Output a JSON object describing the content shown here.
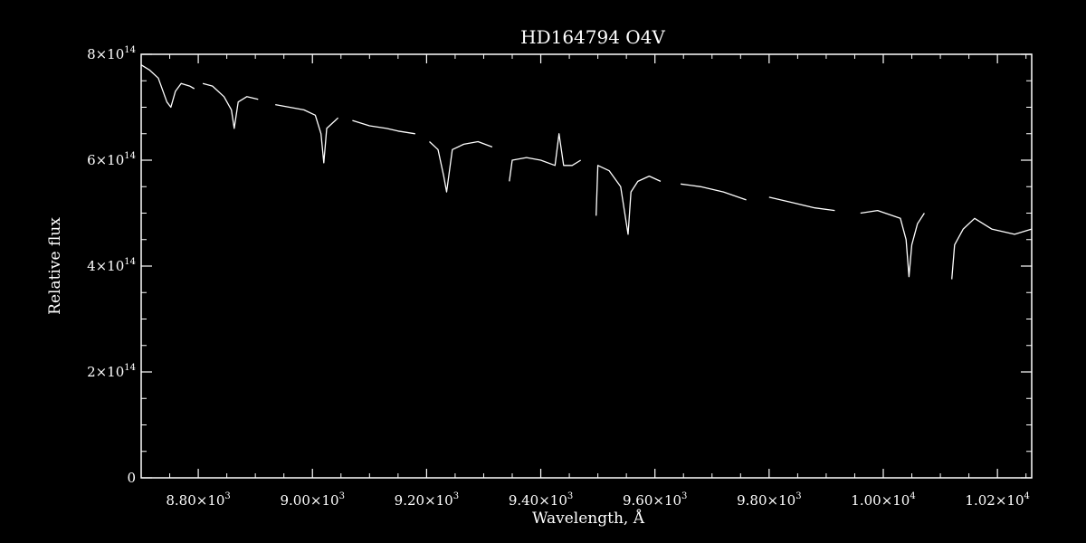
{
  "chart_data": {
    "type": "line",
    "title": "HD164794   O4V",
    "xlabel": "Wavelength, Å",
    "ylabel": "Relative flux",
    "xlim": [
      8700,
      10260
    ],
    "ylim": [
      0,
      800000000000000
    ],
    "grid": false,
    "legend": "none",
    "x_ticks": [
      {
        "value": 8800,
        "mant": "8.80",
        "exp": "3"
      },
      {
        "value": 9000,
        "mant": "9.00",
        "exp": "3"
      },
      {
        "value": 9200,
        "mant": "9.20",
        "exp": "3"
      },
      {
        "value": 9400,
        "mant": "9.40",
        "exp": "3"
      },
      {
        "value": 9600,
        "mant": "9.60",
        "exp": "3"
      },
      {
        "value": 9800,
        "mant": "9.80",
        "exp": "3"
      },
      {
        "value": 10000,
        "mant": "1.00",
        "exp": "4"
      },
      {
        "value": 10200,
        "mant": "1.02",
        "exp": "4"
      }
    ],
    "y_ticks": [
      {
        "value": 0,
        "mant": "0",
        "exp": ""
      },
      {
        "value": 200000000000000,
        "mant": "2",
        "exp": "14"
      },
      {
        "value": 400000000000000,
        "mant": "4",
        "exp": "14"
      },
      {
        "value": 600000000000000,
        "mant": "6",
        "exp": "14"
      },
      {
        "value": 800000000000000,
        "mant": "8",
        "exp": "14"
      }
    ],
    "times_sign": "×10",
    "series": [
      {
        "x": [
          8700,
          8715,
          8730,
          8745,
          8752,
          8760,
          8770,
          8785,
          8793
        ],
        "y": [
          780000000000000.0,
          770000000000000.0,
          755000000000000.0,
          710000000000000.0,
          700000000000000.0,
          730000000000000.0,
          745000000000000.0,
          740000000000000.0,
          735000000000000.0
        ]
      },
      {
        "x": [
          8808,
          8825,
          8845,
          8858,
          8863,
          8870,
          8885,
          8905
        ],
        "y": [
          745000000000000.0,
          740000000000000.0,
          720000000000000.0,
          695000000000000.0,
          660000000000000.0,
          710000000000000.0,
          720000000000000.0,
          715000000000000.0
        ]
      },
      {
        "x": [
          8935,
          8960,
          8985,
          9005,
          9015,
          9020,
          9025,
          9040,
          9045
        ],
        "y": [
          705000000000000.0,
          700000000000000.0,
          695000000000000.0,
          685000000000000.0,
          650000000000000.0,
          595000000000000.0,
          660000000000000.0,
          675000000000000.0,
          680000000000000.0
        ]
      },
      {
        "x": [
          9070,
          9100,
          9130,
          9150,
          9180
        ],
        "y": [
          675000000000000.0,
          665000000000000.0,
          660000000000000.0,
          655000000000000.0,
          650000000000000.0
        ]
      },
      {
        "x": [
          9205,
          9220,
          9230,
          9235,
          9245,
          9265,
          9290,
          9315
        ],
        "y": [
          635000000000000.0,
          620000000000000.0,
          570000000000000.0,
          540000000000000.0,
          620000000000000.0,
          630000000000000.0,
          635000000000000.0,
          625000000000000.0
        ]
      },
      {
        "x": [
          9345,
          9350,
          9375,
          9400,
          9425,
          9432,
          9440,
          9455,
          9470
        ],
        "y": [
          560000000000000.0,
          600000000000000.0,
          605000000000000.0,
          600000000000000.0,
          590000000000000.0,
          650000000000000.0,
          590000000000000.0,
          590000000000000.0,
          600000000000000.0
        ]
      },
      {
        "x": [
          9497,
          9500,
          9520,
          9540,
          9553,
          9558,
          9570,
          9590,
          9610
        ],
        "y": [
          495000000000000.0,
          590000000000000.0,
          580000000000000.0,
          550000000000000.0,
          460000000000000.0,
          540000000000000.0,
          560000000000000.0,
          570000000000000.0,
          560000000000000.0
        ]
      },
      {
        "x": [
          9645,
          9680,
          9720,
          9760
        ],
        "y": [
          555000000000000.0,
          550000000000000.0,
          540000000000000.0,
          525000000000000.0
        ]
      },
      {
        "x": [
          9800,
          9840,
          9880,
          9915
        ],
        "y": [
          530000000000000.0,
          520000000000000.0,
          510000000000000.0,
          505000000000000.0
        ]
      },
      {
        "x": [
          9960,
          9990,
          10030,
          10040,
          10045,
          10050,
          10060,
          10072
        ],
        "y": [
          500000000000000.0,
          505000000000000.0,
          490000000000000.0,
          450000000000000.0,
          380000000000000.0,
          440000000000000.0,
          480000000000000.0,
          500000000000000.0
        ]
      },
      {
        "x": [
          10120,
          10125,
          10140,
          10160,
          10190,
          10230,
          10260
        ],
        "y": [
          375000000000000.0,
          440000000000000.0,
          470000000000000.0,
          490000000000000.0,
          470000000000000.0,
          460000000000000.0,
          470000000000000.0
        ]
      }
    ]
  }
}
